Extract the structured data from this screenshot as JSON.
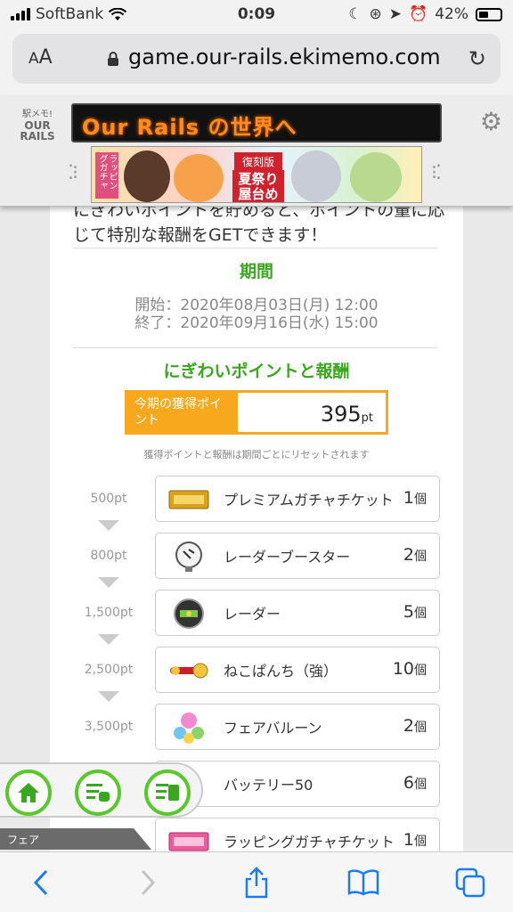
{
  "status": {
    "carrier": "SoftBank",
    "time": "0:09",
    "battery": "42%"
  },
  "browser": {
    "aa_label_small": "A",
    "aa_label": "A",
    "url": "game.our-rails.ekimemo.com"
  },
  "game_header": {
    "logo_line1": "駅メモ!",
    "logo_line2": "OUR RAILS",
    "ticker": "Our Rails の世界へ",
    "banner": {
      "left_text": "ラッピングガチャ",
      "badge": "復刻版",
      "title": "夏祭り屋台めぐり"
    }
  },
  "event": {
    "intro": "にぎわいポイントを貯めると、ポイントの量に応じて特別な報酬をGETできます！",
    "period_title": "期間",
    "start": "開始：2020年08月03日(月) 12:00",
    "end": "終了：2020年09月16日(水) 15:00",
    "points_title": "にぎわいポイントと報酬",
    "points_label": "今期の獲得ポイント",
    "points_value": "395",
    "points_unit": "pt",
    "note": "獲得ポイントと報酬は期間ごとにリセットされます",
    "qty_unit": "個",
    "rewards": [
      {
        "threshold": "500pt",
        "name": "プレミアムガチャチケット",
        "qty": "1"
      },
      {
        "threshold": "800pt",
        "name": "レーダーブースター",
        "qty": "2"
      },
      {
        "threshold": "1,500pt",
        "name": "レーダー",
        "qty": "5"
      },
      {
        "threshold": "2,500pt",
        "name": "ねこぱんち（強）",
        "qty": "10"
      },
      {
        "threshold": "3,500pt",
        "name": "フェアバルーン",
        "qty": "2"
      },
      {
        "threshold": "",
        "name": "バッテリー50",
        "qty": "6"
      },
      {
        "threshold": "",
        "name": "ラッピングガチャチケット",
        "qty": "1"
      }
    ]
  },
  "floating_menu": {
    "tag": "フェア",
    "accent": "#58c82a"
  },
  "colors": {
    "accent_green": "#3aa81f",
    "accent_orange": "#f8a81c",
    "ios_blue": "#1a7cf5"
  }
}
